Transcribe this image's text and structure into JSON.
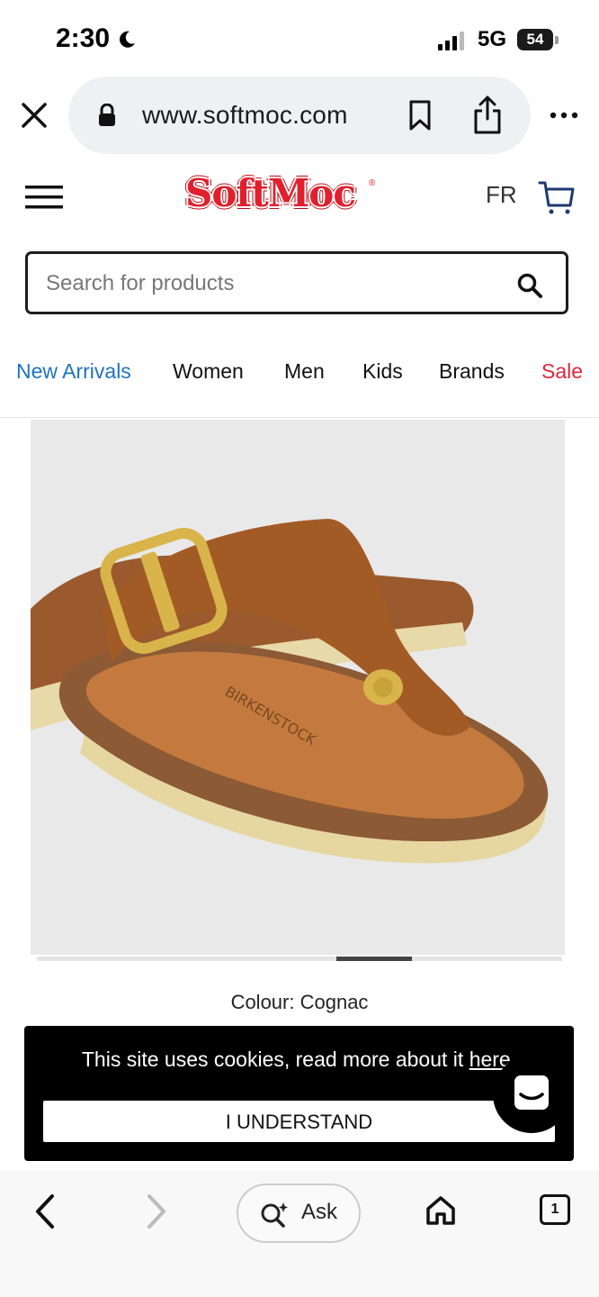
{
  "status_bar": {
    "time": "2:30",
    "network": "5G",
    "battery": "54",
    "icons": [
      "moon-icon",
      "signal-icon",
      "battery-icon"
    ]
  },
  "browser": {
    "url": "www.softmoc.com",
    "icons": [
      "close-icon",
      "lock-icon",
      "bookmark-icon",
      "share-icon",
      "more-icon"
    ]
  },
  "header": {
    "logo_text": "SoftMoc",
    "language_link": "FR",
    "icons": [
      "hamburger-icon",
      "cart-icon"
    ]
  },
  "search": {
    "placeholder": "Search for products",
    "value": ""
  },
  "nav": {
    "items": [
      {
        "label": "New Arrivals",
        "color": "#1e73be"
      },
      {
        "label": "Women"
      },
      {
        "label": "Men"
      },
      {
        "label": "Kids"
      },
      {
        "label": "Brands"
      },
      {
        "label": "Sale",
        "color": "#e0273b"
      }
    ]
  },
  "product": {
    "image_alt": "Birkenstock thong sandal with gold buckle",
    "colour_label": "Colour: Cognac",
    "carousel": {
      "current": 5,
      "total": 7
    }
  },
  "cookie": {
    "message": "This site uses cookies, read more about it ",
    "link_text": "here",
    "suffix": ".",
    "button_label": "I UNDERSTAND"
  },
  "bottom_bar": {
    "ask_label": "Ask",
    "tab_count": "1",
    "icons": [
      "back-icon",
      "forward-icon",
      "ask-sparkle-icon",
      "home-icon",
      "tabs-icon"
    ]
  },
  "colors": {
    "brand_red": "#e0202c",
    "link_blue": "#1e73be",
    "sale_red": "#e0273b"
  }
}
